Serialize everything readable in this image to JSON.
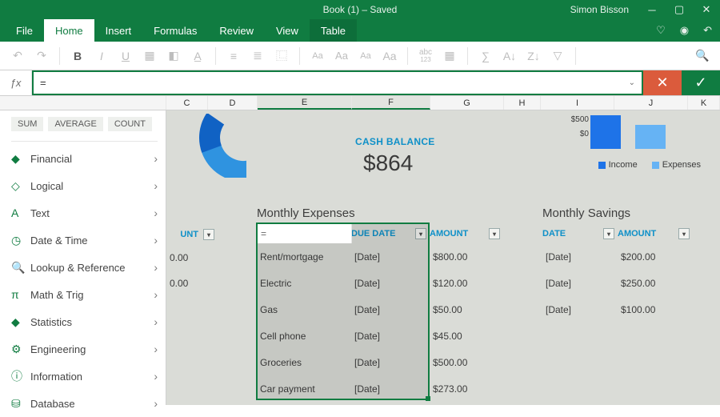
{
  "titlebar": {
    "title": "Book (1) – Saved",
    "user": "Simon Bisson"
  },
  "tabs": {
    "file": "File",
    "home": "Home",
    "insert": "Insert",
    "formulas": "Formulas",
    "review": "Review",
    "view": "View",
    "table": "Table"
  },
  "formula_bar": {
    "value": "="
  },
  "columns": [
    "C",
    "D",
    "E",
    "F",
    "G",
    "H",
    "I",
    "J",
    "K"
  ],
  "autocomplete": {
    "chips": [
      "SUM",
      "AVERAGE",
      "COUNT"
    ],
    "categories": [
      "Financial",
      "Logical",
      "Text",
      "Date & Time",
      "Lookup & Reference",
      "Math & Trig",
      "Statistics",
      "Engineering",
      "Information",
      "Database"
    ]
  },
  "cash": {
    "label": "CASH BALANCE",
    "value": "$864"
  },
  "chart_data": {
    "type": "bar",
    "categories": [
      "Income",
      "Expenses"
    ],
    "values": [
      900,
      650
    ],
    "ylim": [
      0,
      1000
    ],
    "yticks_visible": [
      "$500",
      "$0"
    ],
    "legend": [
      "Income",
      "Expenses"
    ],
    "colors": {
      "income": "#1E73E8",
      "expenses": "#66B3F4"
    }
  },
  "expenses": {
    "title": "Monthly Expenses",
    "headers": {
      "due": "DUE DATE",
      "amount": "AMOUNT"
    },
    "input": "=",
    "rows": [
      {
        "item": "Rent/mortgage",
        "due": "[Date]",
        "amount": "$800.00"
      },
      {
        "item": "Electric",
        "due": "[Date]",
        "amount": "$120.00"
      },
      {
        "item": "Gas",
        "due": "[Date]",
        "amount": "$50.00"
      },
      {
        "item": "Cell phone",
        "due": "[Date]",
        "amount": "$45.00"
      },
      {
        "item": "Groceries",
        "due": "[Date]",
        "amount": "$500.00"
      },
      {
        "item": "Car payment",
        "due": "[Date]",
        "amount": "$273.00"
      }
    ]
  },
  "partial_table": {
    "header": "UNT",
    "rows": [
      "0.00",
      "0.00"
    ]
  },
  "savings": {
    "title": "Monthly Savings",
    "headers": {
      "date": "DATE",
      "amount": "AMOUNT"
    },
    "rows": [
      {
        "date": "[Date]",
        "amount": "$200.00"
      },
      {
        "date": "[Date]",
        "amount": "$250.00"
      },
      {
        "date": "[Date]",
        "amount": "$100.00"
      }
    ]
  }
}
